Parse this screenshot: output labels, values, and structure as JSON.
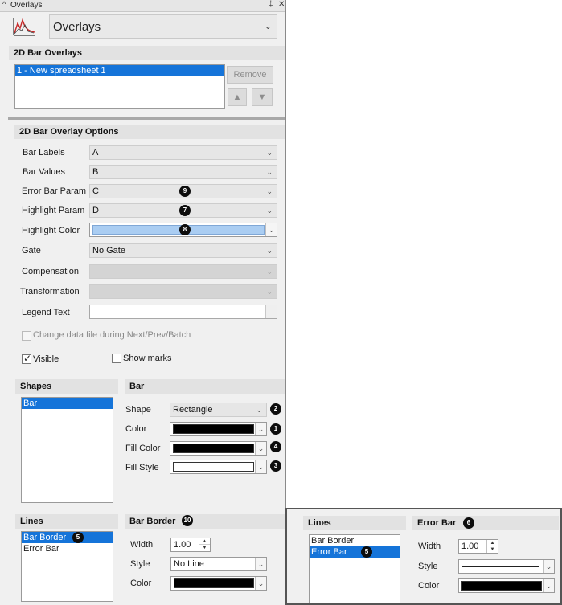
{
  "window": {
    "title": "Overlays",
    "pin_glyph": "‡",
    "close_glyph": "✕",
    "collapse_glyph": "^"
  },
  "header": {
    "selector_value": "Overlays",
    "icon": "bar-chart-line-icon"
  },
  "overlays_section": {
    "title": "2D Bar Overlays",
    "items": [
      "1 - New spreadsheet 1"
    ],
    "remove_label": "Remove",
    "up_glyph": "▲",
    "down_glyph": "▼"
  },
  "options_section": {
    "title": "2D Bar Overlay Options",
    "bar_labels": {
      "label": "Bar Labels",
      "value": "A"
    },
    "bar_values": {
      "label": "Bar Values",
      "value": "B"
    },
    "error_bar_param": {
      "label": "Error Bar Param",
      "value": "C",
      "badge": "9"
    },
    "highlight_param": {
      "label": "Highlight Param",
      "value": "D",
      "badge": "7"
    },
    "highlight_color": {
      "label": "Highlight Color",
      "color": "#aacdf2",
      "badge": "8"
    },
    "gate": {
      "label": "Gate",
      "value": "No Gate"
    },
    "compensation": {
      "label": "Compensation",
      "value": ""
    },
    "transformation": {
      "label": "Transformation",
      "value": ""
    },
    "legend_text": {
      "label": "Legend Text",
      "value": "",
      "button": "..."
    },
    "change_data_file": {
      "label": "Change data file during Next/Prev/Batch",
      "checked": false
    },
    "visible": {
      "label": "Visible",
      "checked": true
    },
    "show_marks": {
      "label": "Show marks",
      "checked": false
    }
  },
  "shapes": {
    "title": "Shapes",
    "items": [
      "Bar"
    ]
  },
  "bar": {
    "title": "Bar",
    "shape": {
      "label": "Shape",
      "value": "Rectangle",
      "badge": "2"
    },
    "color": {
      "label": "Color",
      "color": "#000000",
      "badge": "1"
    },
    "fill_color": {
      "label": "Fill Color",
      "color": "#000000",
      "badge": "4"
    },
    "fill_style": {
      "label": "Fill Style",
      "color": "#ffffff",
      "badge": "3"
    }
  },
  "lines": {
    "title": "Lines",
    "items": [
      "Bar Border",
      "Error Bar"
    ],
    "selected_badge": "5"
  },
  "bar_border": {
    "title": "Bar Border",
    "badge": "10",
    "width": {
      "label": "Width",
      "value": "1.00"
    },
    "style": {
      "label": "Style",
      "value": "No Line"
    },
    "color": {
      "label": "Color",
      "color": "#000000"
    }
  },
  "inset": {
    "lines_title": "Lines",
    "items": [
      "Bar Border",
      "Error Bar"
    ],
    "selected_badge": "5",
    "error_bar": {
      "title": "Error Bar",
      "badge": "6",
      "width": {
        "label": "Width",
        "value": "1.00"
      },
      "style": {
        "label": "Style"
      },
      "color": {
        "label": "Color",
        "color": "#000000"
      }
    }
  },
  "colors": {
    "selection": "#1574d9",
    "badge_bg": "#0d0d0d"
  }
}
